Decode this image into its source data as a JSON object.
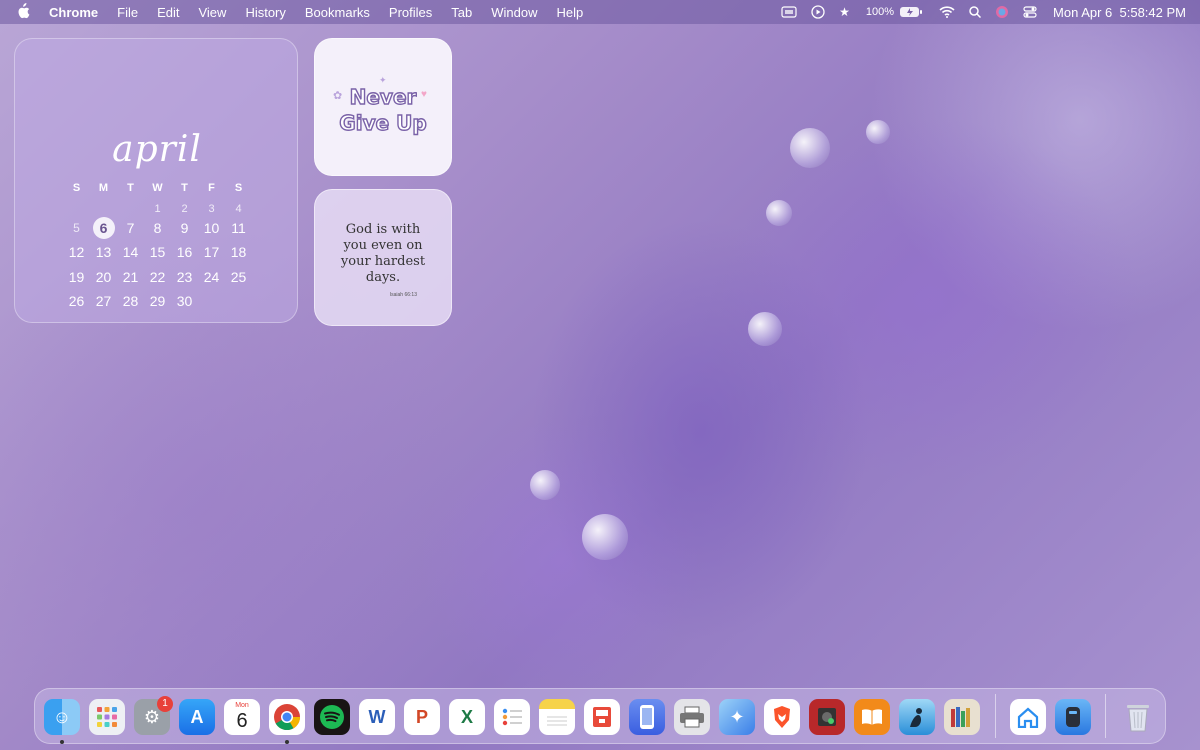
{
  "menubar": {
    "app": "Chrome",
    "menus": [
      "File",
      "Edit",
      "View",
      "History",
      "Bookmarks",
      "Profiles",
      "Tab",
      "Window",
      "Help"
    ],
    "battery": "100%",
    "datetime": "Mon Apr 6  5:58:42 PM"
  },
  "calendar": {
    "month": "april",
    "days_header": [
      "S",
      "M",
      "T",
      "W",
      "T",
      "F",
      "S"
    ],
    "row_pre": [
      "",
      "",
      "",
      "1",
      "2",
      "3",
      "4"
    ],
    "rows": [
      [
        "5",
        "6",
        "7",
        "8",
        "9",
        "10",
        "11"
      ],
      [
        "12",
        "13",
        "14",
        "15",
        "16",
        "17",
        "18"
      ],
      [
        "19",
        "20",
        "21",
        "22",
        "23",
        "24",
        "25"
      ],
      [
        "26",
        "27",
        "28",
        "29",
        "30",
        "",
        ""
      ]
    ],
    "today": "6"
  },
  "quote_widget": {
    "line1": "Never",
    "line2": "Give Up"
  },
  "verse_widget": {
    "text_l1": "God is with",
    "text_l2": "you even on",
    "text_l3": "your hardest",
    "text_l4": "days.",
    "ref": "Isaiah 66:13"
  },
  "dock": {
    "calendar_icon_month": "Mon",
    "calendar_icon_day": "6",
    "settings_badge": "1"
  }
}
